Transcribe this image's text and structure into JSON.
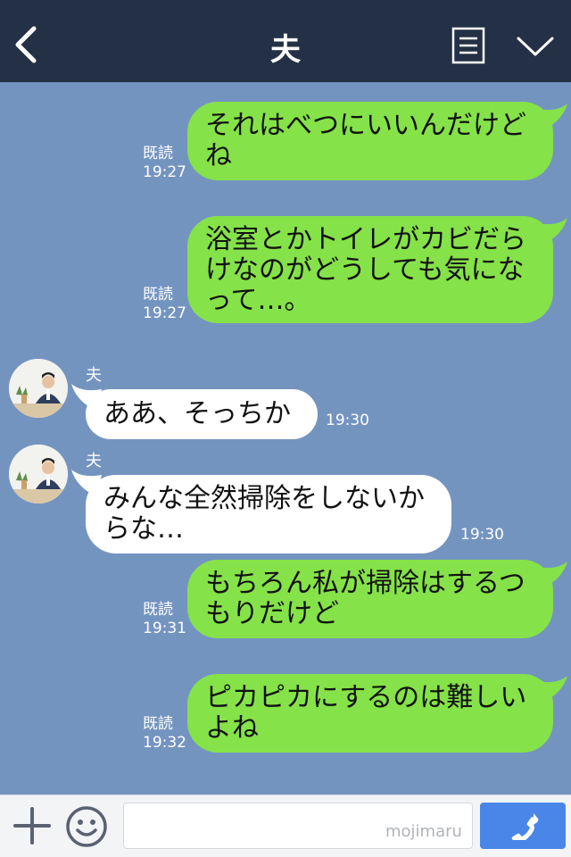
{
  "header": {
    "title": "夫",
    "back_icon": "chevron-left-icon",
    "notes_icon": "notes-icon",
    "menu_icon": "chevron-down-icon"
  },
  "messages": [
    {
      "dir": "out",
      "lines": [
        "それはべつにいいんだけど",
        "ね"
      ],
      "read": "既読",
      "time": "19:27"
    },
    {
      "dir": "out",
      "lines": [
        "浴室とかトイレがカビだら",
        "けなのがどうしても気にな",
        "って…。"
      ],
      "read": "既読",
      "time": "19:27"
    },
    {
      "dir": "in",
      "sender": "夫",
      "lines": [
        "ああ、そっちか"
      ],
      "time": "19:30"
    },
    {
      "dir": "in",
      "sender": "夫",
      "lines": [
        "みんな全然掃除をしないか",
        "らな…"
      ],
      "time": "19:30"
    },
    {
      "dir": "out",
      "lines": [
        "もちろん私が掃除はするつ",
        "もりだけど"
      ],
      "read": "既読",
      "time": "19:31"
    },
    {
      "dir": "out",
      "lines": [
        "ピカピカにするのは難しい",
        "よね"
      ],
      "read": "既読",
      "time": "19:32"
    }
  ],
  "footer": {
    "input_value": "",
    "watermark": "mojimaru",
    "plus_icon": "plus-icon",
    "emoji_icon": "smiley-icon",
    "call_icon": "phone-icon"
  },
  "colors": {
    "header": "#243045",
    "background": "#7494c0",
    "bubble_out": "#85e249",
    "bubble_in": "#ffffff",
    "call_button": "#4a86e8"
  }
}
